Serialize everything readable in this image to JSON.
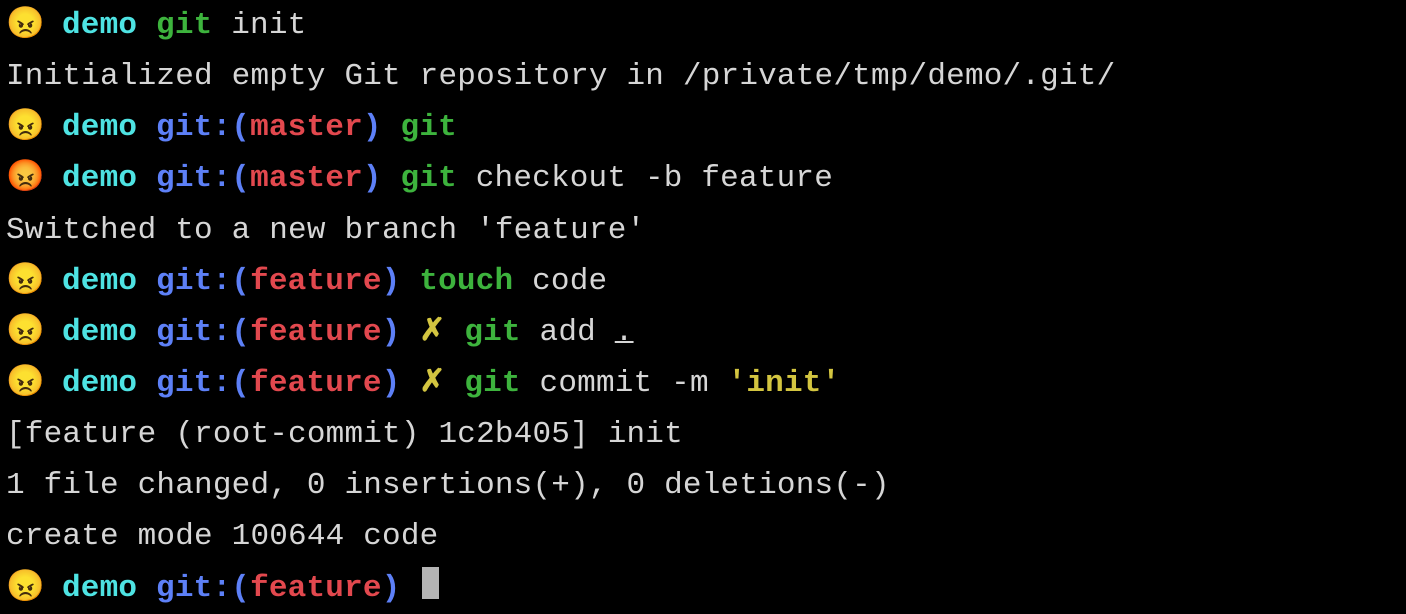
{
  "emojis": {
    "angry_face": "😠",
    "pouting_face": "😡"
  },
  "colors": {
    "cyan": "#4ee3e3",
    "blue": "#5d80f7",
    "red": "#e2484e",
    "green": "#3db33d",
    "yellow": "#d3c540",
    "plain": "#d6d6d6",
    "bg": "#000000"
  },
  "lines": [
    {
      "type": "prompt",
      "emoji": "angry_face",
      "dir": "demo",
      "branch": null,
      "dirty": false,
      "segments": [
        {
          "style": "green",
          "text": "git"
        },
        {
          "style": "plain",
          "text": " init"
        }
      ]
    },
    {
      "type": "output",
      "text": "Initialized empty Git repository in /private/tmp/demo/.git/"
    },
    {
      "type": "prompt",
      "emoji": "angry_face",
      "dir": "demo",
      "git_label": "git:",
      "branch": "master",
      "dirty": false,
      "segments": [
        {
          "style": "green",
          "text": "git"
        }
      ]
    },
    {
      "type": "prompt",
      "emoji": "pouting_face",
      "dir": "demo",
      "git_label": "git:",
      "branch": "master",
      "dirty": false,
      "segments": [
        {
          "style": "green",
          "text": "git"
        },
        {
          "style": "plain",
          "text": " checkout -b feature"
        }
      ]
    },
    {
      "type": "output",
      "text": "Switched to a new branch 'feature'"
    },
    {
      "type": "prompt",
      "emoji": "angry_face",
      "dir": "demo",
      "git_label": "git:",
      "branch": "feature",
      "dirty": false,
      "segments": [
        {
          "style": "green",
          "text": "touch"
        },
        {
          "style": "plain",
          "text": " code"
        }
      ]
    },
    {
      "type": "prompt",
      "emoji": "angry_face",
      "dir": "demo",
      "git_label": "git:",
      "branch": "feature",
      "dirty": true,
      "dirty_mark": "✗",
      "segments": [
        {
          "style": "green",
          "text": "git"
        },
        {
          "style": "plain",
          "text": " add "
        },
        {
          "style": "plain underline",
          "text": "."
        }
      ]
    },
    {
      "type": "prompt",
      "emoji": "angry_face",
      "dir": "demo",
      "git_label": "git:",
      "branch": "feature",
      "dirty": true,
      "dirty_mark": "✗",
      "segments": [
        {
          "style": "green",
          "text": "git"
        },
        {
          "style": "plain",
          "text": " commit -m "
        },
        {
          "style": "yellow",
          "text": "'init'"
        }
      ]
    },
    {
      "type": "output",
      "text": "[feature (root-commit) 1c2b405] init"
    },
    {
      "type": "output",
      "text": " 1 file changed, 0 insertions(+), 0 deletions(-)"
    },
    {
      "type": "output",
      "text": " create mode 100644 code"
    },
    {
      "type": "prompt",
      "emoji": "angry_face",
      "dir": "demo",
      "git_label": "git:",
      "branch": "feature",
      "dirty": false,
      "cursor": true,
      "segments": []
    }
  ]
}
